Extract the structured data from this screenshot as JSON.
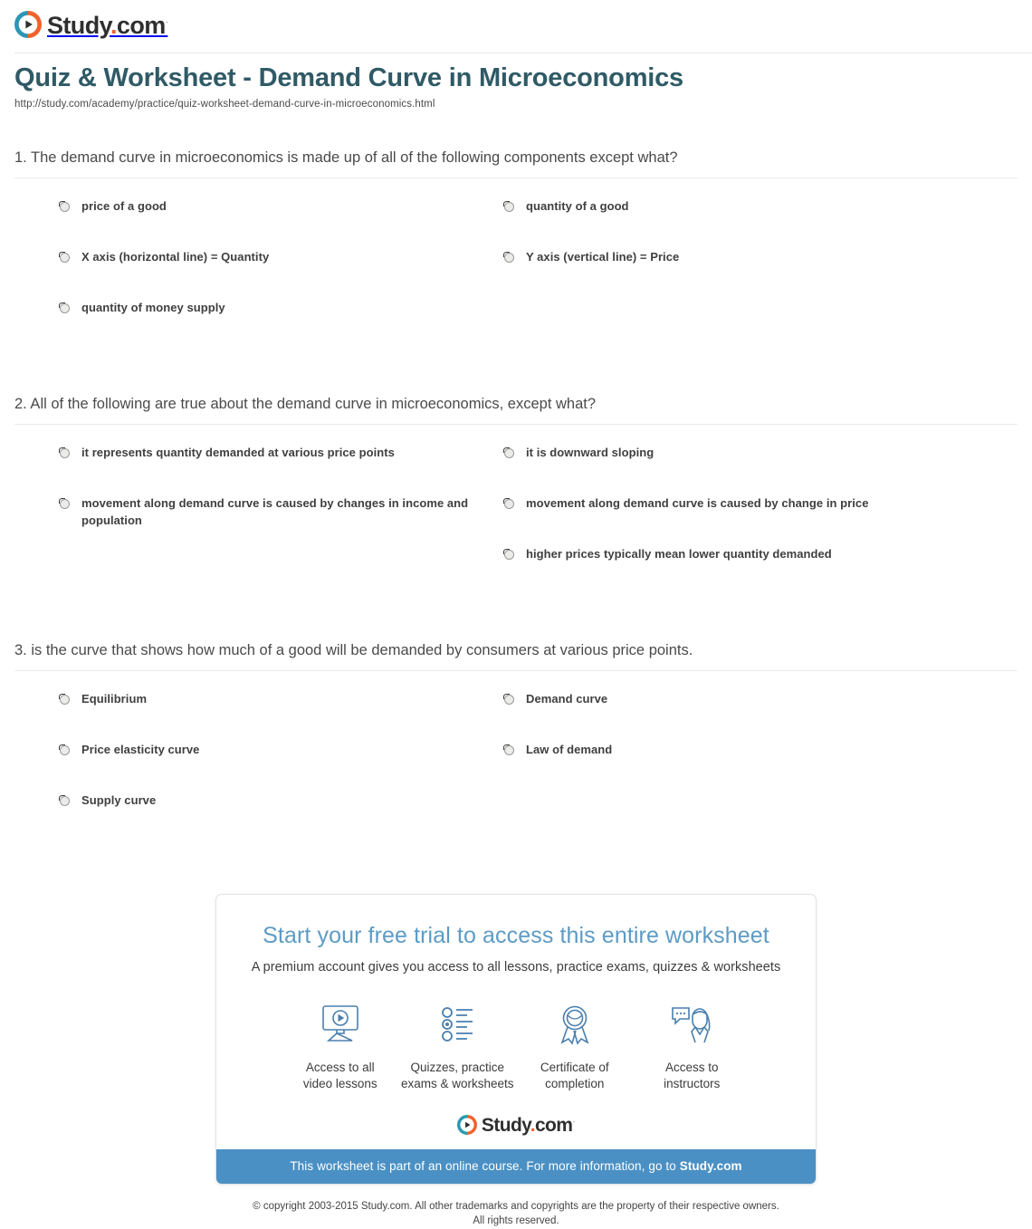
{
  "brand": {
    "name": "Study.com",
    "name_main": "Study",
    "name_dot": ".",
    "name_suffix": "com",
    "trademark": "®",
    "logo_ring_blue": "#2b97b5",
    "logo_ring_orange": "#f0622b",
    "accent_blue": "#4a90c4",
    "title_color": "#2f5a66"
  },
  "header": {
    "title": "Quiz & Worksheet - Demand Curve in Microeconomics",
    "url": "http://study.com/academy/practice/quiz-worksheet-demand-curve-in-microeconomics.html"
  },
  "questions": [
    {
      "number": "1.",
      "text": "1. The demand curve in microeconomics is made up of all of the following components except what?",
      "left_options": [
        "price of a good",
        "X axis (horizontal line) = Quantity",
        "quantity of money supply"
      ],
      "right_options": [
        "quantity of a good",
        "Y axis (vertical line) = Price"
      ]
    },
    {
      "number": "2.",
      "text": "2. All of the following are true about the demand curve in microeconomics, except what?",
      "left_options": [
        "it represents quantity demanded at various price points",
        "movement along demand curve is caused by changes in income and population"
      ],
      "right_options": [
        "it is downward sloping",
        "movement along demand curve is caused by change in price",
        "higher prices typically mean lower quantity demanded"
      ]
    },
    {
      "number": "3.",
      "text": "3. is the curve that shows how much of a good will be demanded by consumers at various price points.",
      "left_options": [
        "Equilibrium",
        "Price elasticity curve",
        "Supply curve"
      ],
      "right_options": [
        "Demand curve",
        "Law of demand"
      ]
    }
  ],
  "promo": {
    "title": "Start your free trial to access this entire worksheet",
    "subtitle": "A premium account gives you access to all lessons, practice exams, quizzes & worksheets",
    "features": [
      {
        "icon": "monitor-play-icon",
        "label": "Access to all\nvideo lessons"
      },
      {
        "icon": "checklist-icon",
        "label": "Quizzes, practice\nexams & worksheets"
      },
      {
        "icon": "award-ribbon-icon",
        "label": "Certificate of\ncompletion"
      },
      {
        "icon": "instructor-chat-icon",
        "label": "Access to\ninstructors"
      }
    ],
    "bar_text_prefix": "This worksheet is part of an online course. For more information, go to ",
    "bar_text_brand": "Study.com"
  },
  "footer": {
    "copyright": "© copyright 2003-2015 Study.com. All other trademarks and copyrights are the property of their respective owners.\nAll rights reserved."
  }
}
